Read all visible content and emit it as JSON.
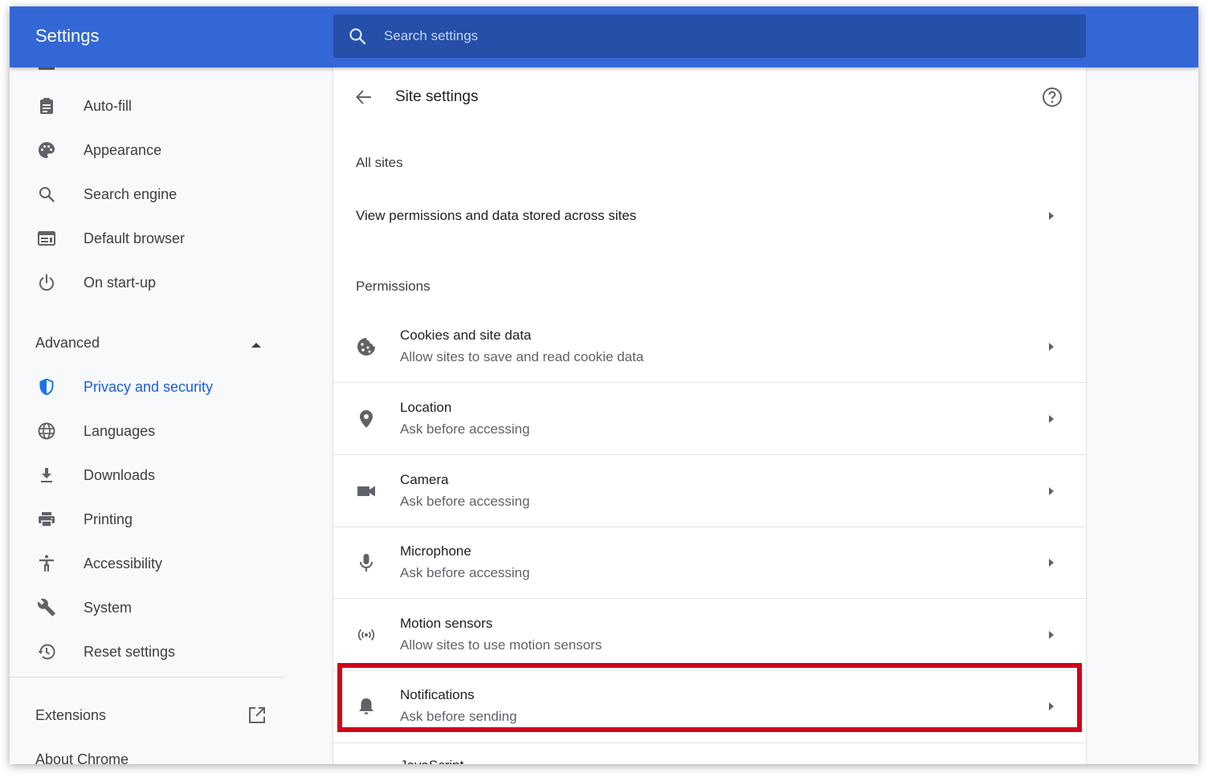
{
  "header": {
    "title": "Settings",
    "search_placeholder": "Search settings"
  },
  "sidebar": {
    "items": [
      {
        "label": "Auto-fill",
        "icon": "clipboard-icon"
      },
      {
        "label": "Appearance",
        "icon": "palette-icon"
      },
      {
        "label": "Search engine",
        "icon": "search-icon"
      },
      {
        "label": "Default browser",
        "icon": "browser-icon"
      },
      {
        "label": "On start-up",
        "icon": "power-icon"
      }
    ],
    "advanced_label": "Advanced",
    "advanced_items": [
      {
        "label": "Privacy and security",
        "icon": "shield-icon",
        "active": true
      },
      {
        "label": "Languages",
        "icon": "globe-icon"
      },
      {
        "label": "Downloads",
        "icon": "download-icon"
      },
      {
        "label": "Printing",
        "icon": "printer-icon"
      },
      {
        "label": "Accessibility",
        "icon": "accessibility-icon"
      },
      {
        "label": "System",
        "icon": "wrench-icon"
      },
      {
        "label": "Reset settings",
        "icon": "history-icon"
      }
    ],
    "extensions_label": "Extensions",
    "about_label": "About Chrome"
  },
  "main": {
    "page_title": "Site settings",
    "all_sites_heading": "All sites",
    "all_sites_row": "View permissions and data stored across sites",
    "permissions_heading": "Permissions",
    "permissions": [
      {
        "title": "Cookies and site data",
        "subtitle": "Allow sites to save and read cookie data",
        "icon": "cookie-icon"
      },
      {
        "title": "Location",
        "subtitle": "Ask before accessing",
        "icon": "location-pin-icon"
      },
      {
        "title": "Camera",
        "subtitle": "Ask before accessing",
        "icon": "camera-icon"
      },
      {
        "title": "Microphone",
        "subtitle": "Ask before accessing",
        "icon": "microphone-icon"
      },
      {
        "title": "Motion sensors",
        "subtitle": "Allow sites to use motion sensors",
        "icon": "motion-sensor-icon"
      },
      {
        "title": "Notifications",
        "subtitle": "Ask before sending",
        "icon": "bell-icon"
      }
    ],
    "next_row_title": "JavaScript"
  },
  "colors": {
    "header_bg": "#3367d6",
    "search_bg": "#254fa8",
    "active_accent": "#1a5ce0",
    "highlight_border": "#d0021b"
  }
}
